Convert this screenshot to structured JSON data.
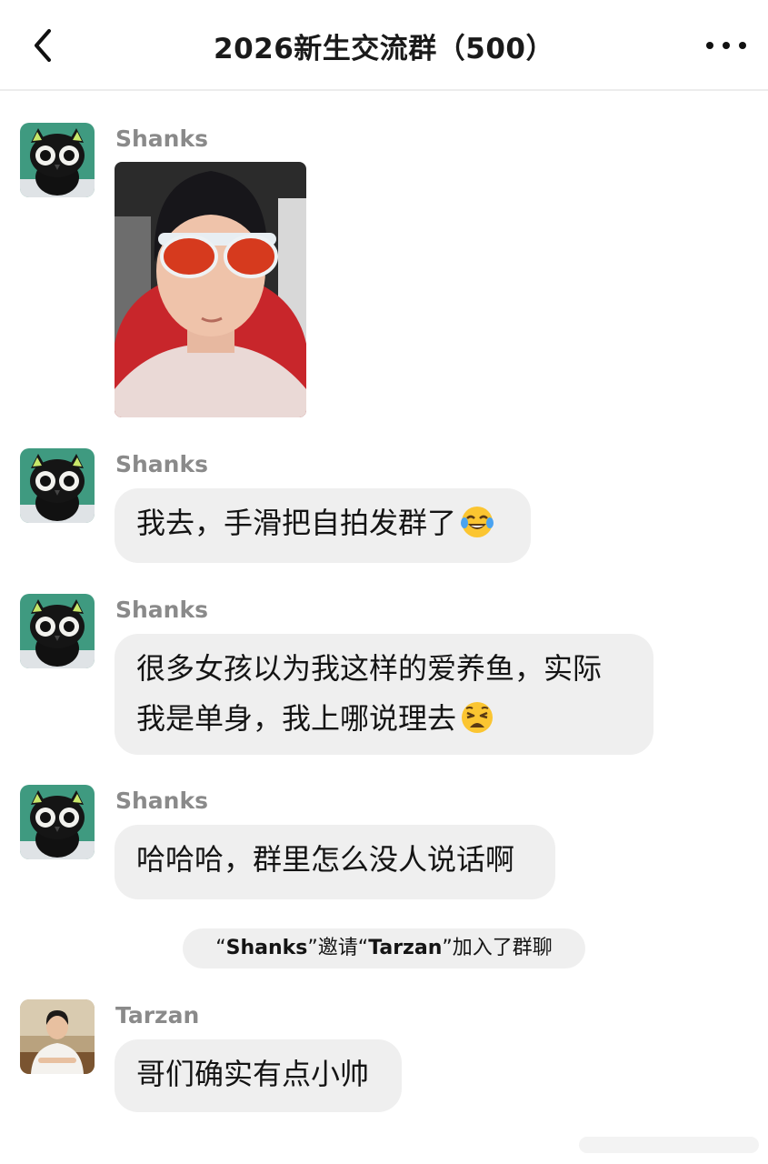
{
  "header": {
    "title": "2026新生交流群（500）"
  },
  "messages": [
    {
      "sender": "Shanks",
      "type": "image"
    },
    {
      "sender": "Shanks",
      "text": "我去，手滑把自拍发群了",
      "emoji": "face-with-tears-of-joy"
    },
    {
      "sender": "Shanks",
      "line1": "很多女孩以为我这样的爱养鱼，实际",
      "line2": "我是单身，我上哪说理去",
      "emoji": "weary-face"
    },
    {
      "sender": "Shanks",
      "text": "哈哈哈，群里怎么没人说话啊"
    },
    {
      "sender": "Tarzan",
      "text": "哥们确实有点小帅"
    }
  ],
  "system_notice": {
    "q_open_1": "“",
    "inviter": "Shanks",
    "q_close_1": "”",
    "verb": "邀请",
    "q_open_2": "“",
    "invitee": "Tarzan",
    "q_close_2": "”",
    "suffix": "加入了群聊"
  },
  "colors": {
    "bubble": "#efefef",
    "sender_name": "#8a8a8a",
    "text": "#141414",
    "divider": "#ececec"
  }
}
